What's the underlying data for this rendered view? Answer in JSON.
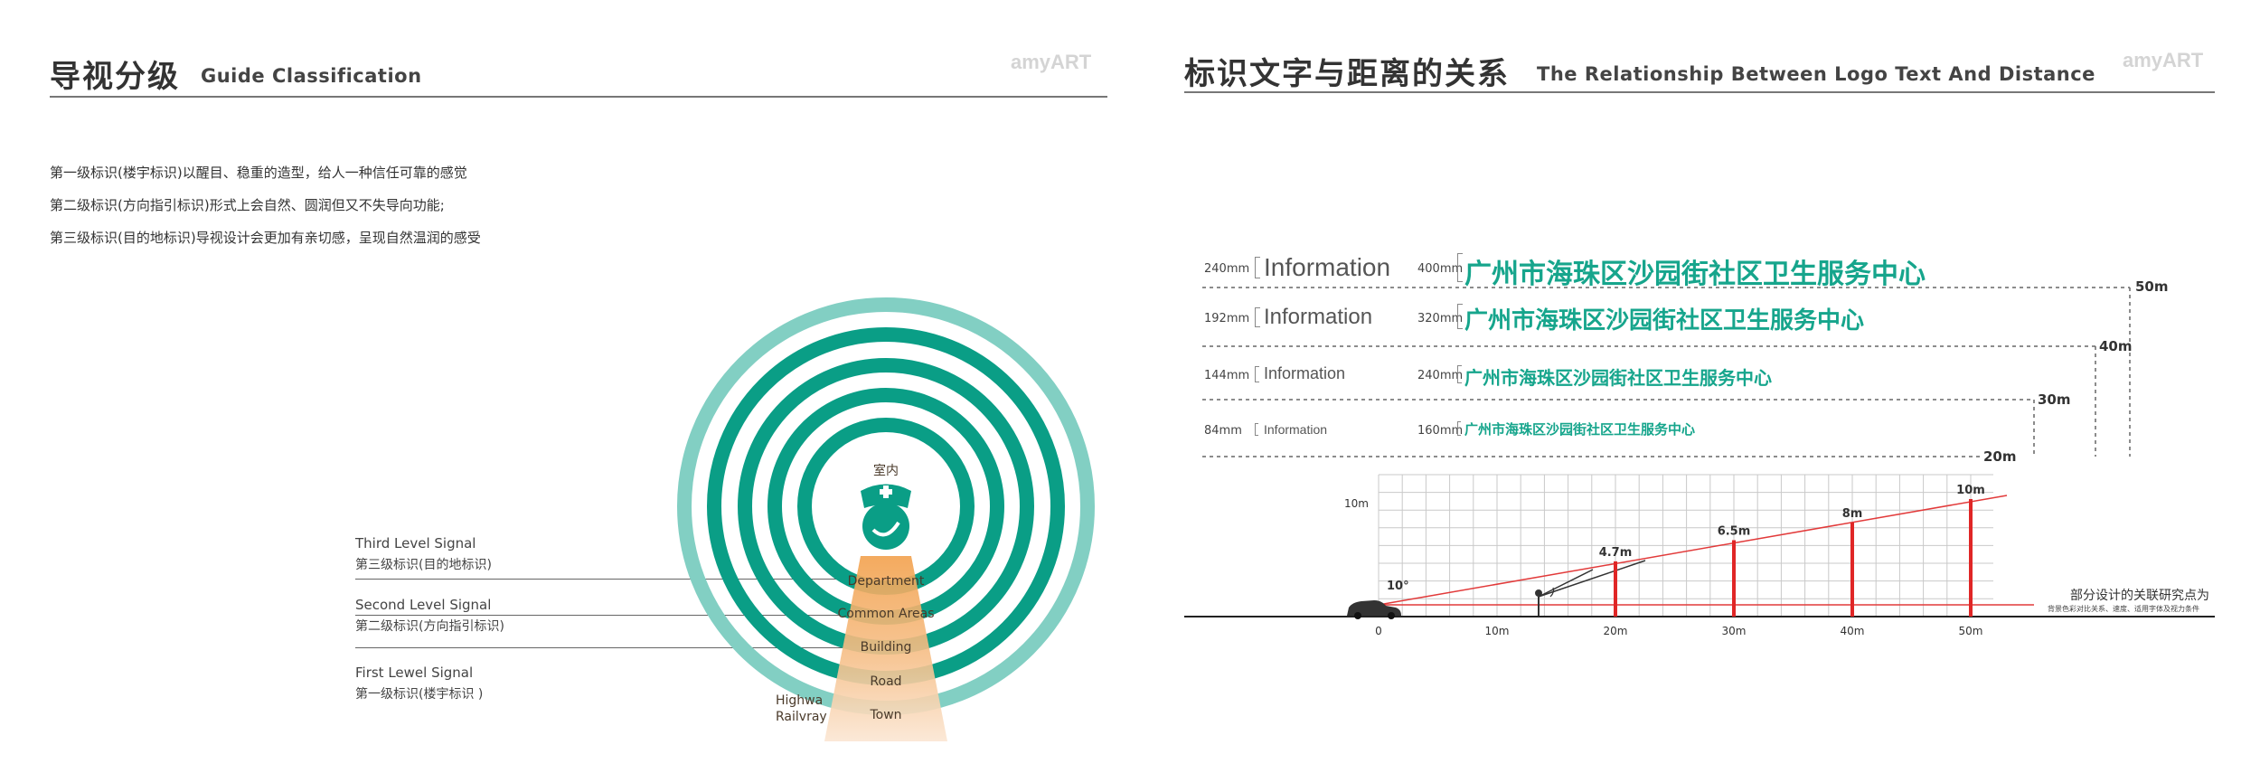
{
  "left": {
    "title_zh": "导视分级",
    "title_en": "Guide Classification",
    "logo": "amyART",
    "descriptions": [
      "第一级标识(楼宇标识)以醒目、稳重的造型，给人一种信任可靠的感觉",
      "第二级标识(方向指引标识)形式上会自然、圆润但又不失导向功能;",
      "第三级标识(目的地标识)导视设计会更加有亲切感，呈现自然温润的感受"
    ],
    "levels": [
      {
        "en": "Third Level Signal",
        "zh": "第三级标识(目的地标识)"
      },
      {
        "en": "Second Level Signal",
        "zh": "第二级标识(方向指引标识)"
      },
      {
        "en": "First Lewel Signal",
        "zh": "第一级标识(楼宇标识 )"
      }
    ],
    "center_label": "室内",
    "ring_labels": [
      "Department",
      "Common Areas",
      "Building",
      "Road",
      "Town"
    ],
    "side_labels": [
      "Highwa",
      "Railvray"
    ],
    "colors": {
      "ring_dark": "#0a9e86",
      "ring_light": "#82cfc3",
      "cone": "#f2a14d",
      "cone_light": "#f9dcc0"
    }
  },
  "right": {
    "title_zh": "标识文字与距离的关系",
    "title_en": "The Relationship Between Logo Text And Distance",
    "logo": "amyART",
    "rows": [
      {
        "size_en": "240mm",
        "en": "Information",
        "size_zh": "400mm",
        "zh": "广州市海珠区沙园街社区卫生服务中心",
        "dist": "50m"
      },
      {
        "size_en": "192mm",
        "en": "Information",
        "size_zh": "320mm",
        "zh": "广州市海珠区沙园街社区卫生服务中心",
        "dist": "40m"
      },
      {
        "size_en": "144mm",
        "en": "Information",
        "size_zh": "240mm",
        "zh": "广州市海珠区沙园街社区卫生服务中心",
        "dist": "30m"
      },
      {
        "size_en": "84mm",
        "en": "Information",
        "size_zh": "160mm",
        "zh": "广州市海珠区沙园街社区卫生服务中心",
        "dist": "20m"
      }
    ],
    "chart": {
      "y_label": "10m",
      "angle_label": "10°",
      "x_ticks": [
        "0",
        "10m",
        "20m",
        "30m",
        "40m",
        "50m"
      ],
      "bars": [
        {
          "x": 20,
          "h": 4.7,
          "label": "4.7m"
        },
        {
          "x": 30,
          "h": 6.5,
          "label": "6.5m"
        },
        {
          "x": 40,
          "h": 8,
          "label": "8m"
        },
        {
          "x": 50,
          "h": 10,
          "label": "10m"
        }
      ]
    },
    "note_main": "部分设计的关联研究点为",
    "note_sub": "背景色彩对比关系、速度、适用字体及视力条件"
  }
}
